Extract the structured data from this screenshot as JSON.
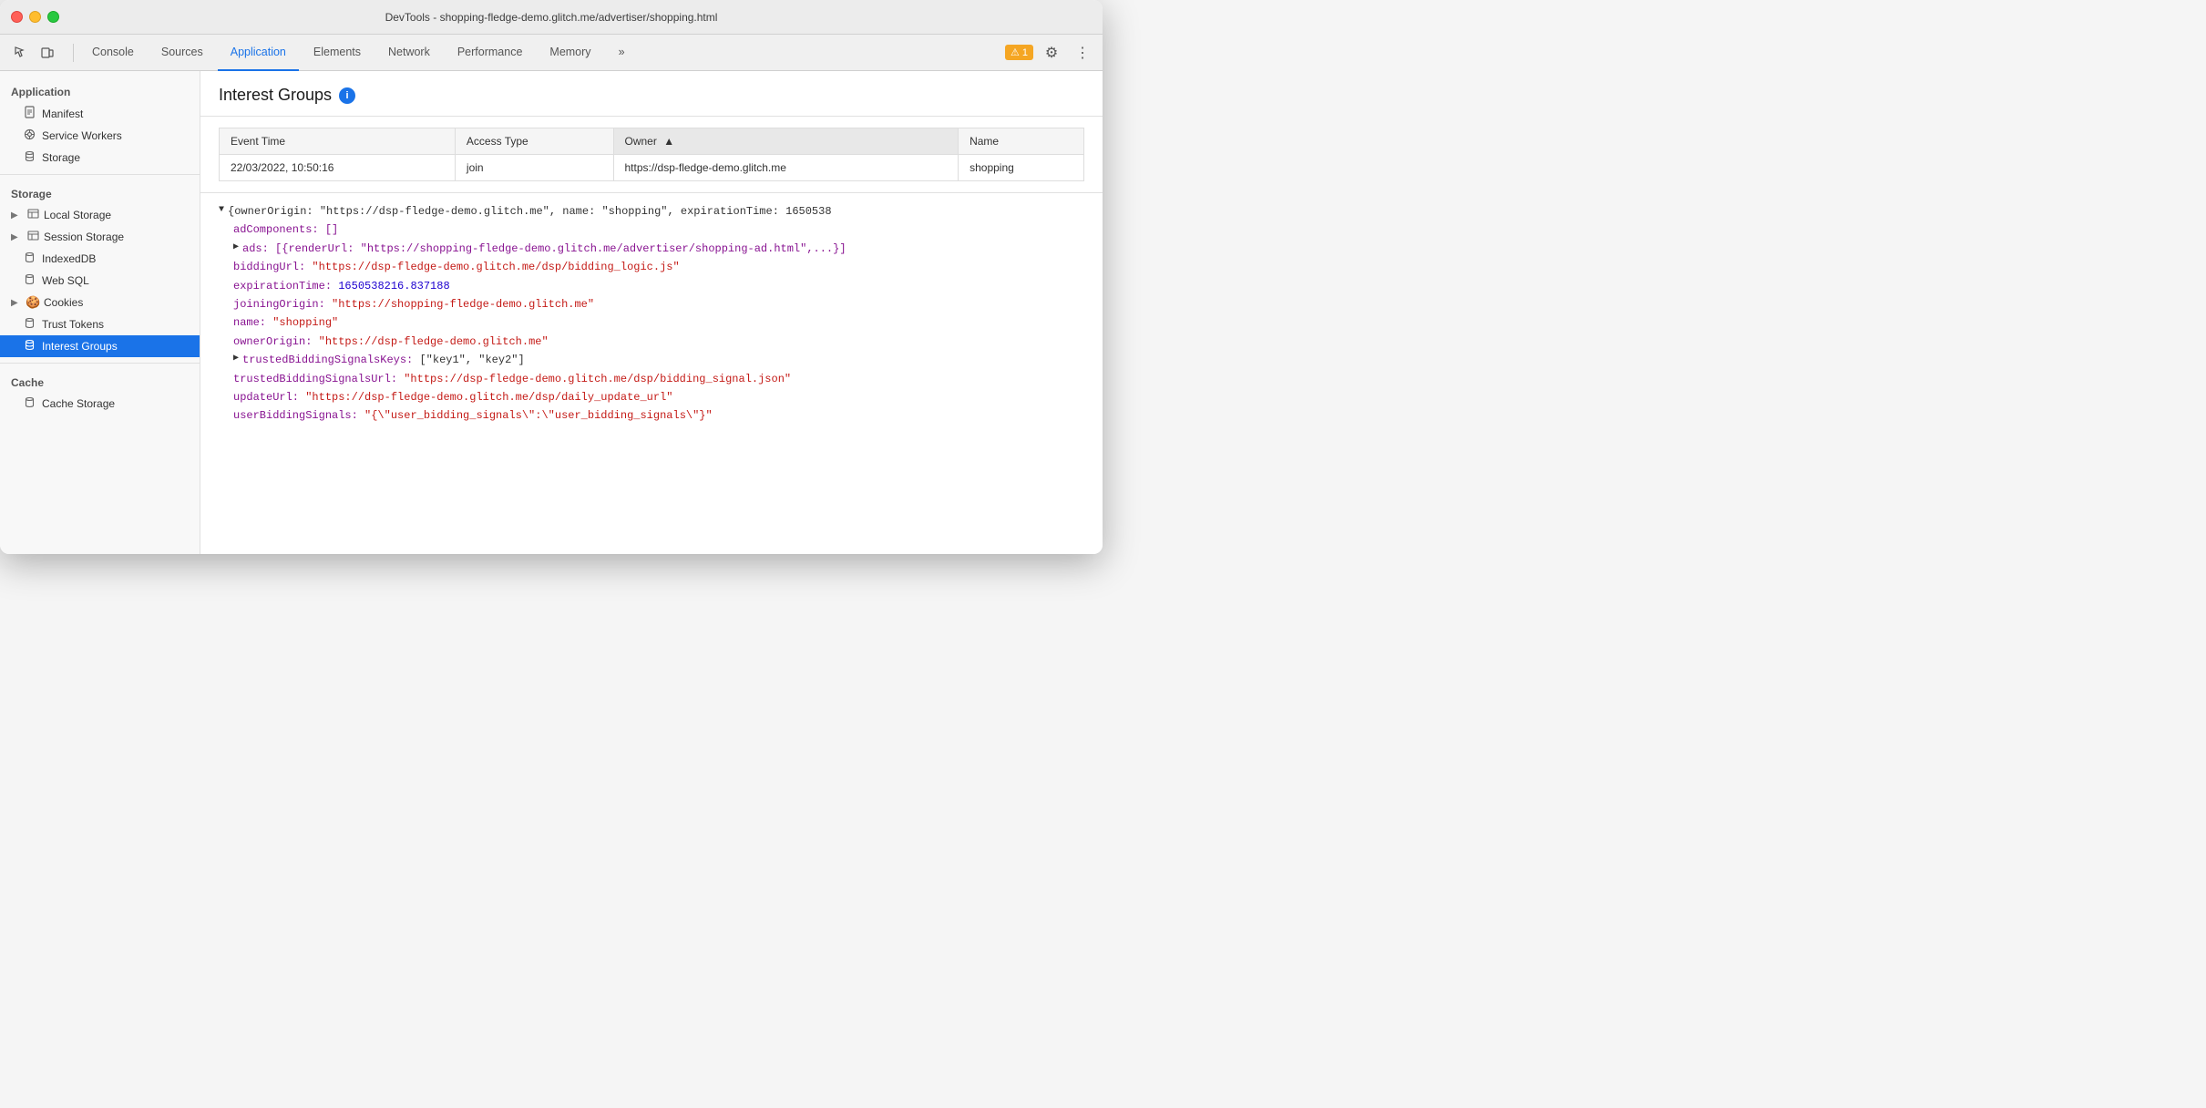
{
  "window": {
    "title": "DevTools - shopping-fledge-demo.glitch.me/advertiser/shopping.html"
  },
  "toolbar": {
    "tabs": [
      {
        "id": "console",
        "label": "Console",
        "active": false
      },
      {
        "id": "sources",
        "label": "Sources",
        "active": false
      },
      {
        "id": "application",
        "label": "Application",
        "active": true
      },
      {
        "id": "elements",
        "label": "Elements",
        "active": false
      },
      {
        "id": "network",
        "label": "Network",
        "active": false
      },
      {
        "id": "performance",
        "label": "Performance",
        "active": false
      },
      {
        "id": "memory",
        "label": "Memory",
        "active": false
      }
    ],
    "more_label": "»",
    "warning_count": "1",
    "warning_icon": "⚠"
  },
  "sidebar": {
    "sections": [
      {
        "id": "application",
        "title": "Application",
        "items": [
          {
            "id": "manifest",
            "label": "Manifest",
            "icon": "📄",
            "icon_type": "file"
          },
          {
            "id": "service-workers",
            "label": "Service Workers",
            "icon": "⚙",
            "icon_type": "gear"
          },
          {
            "id": "storage",
            "label": "Storage",
            "icon": "🗄",
            "icon_type": "db"
          }
        ]
      },
      {
        "id": "storage",
        "title": "Storage",
        "items": [
          {
            "id": "local-storage",
            "label": "Local Storage",
            "icon": "⊞",
            "icon_type": "grid",
            "expandable": true
          },
          {
            "id": "session-storage",
            "label": "Session Storage",
            "icon": "⊞",
            "icon_type": "grid",
            "expandable": true
          },
          {
            "id": "indexeddb",
            "label": "IndexedDB",
            "icon": "🗄",
            "icon_type": "db",
            "expandable": false
          },
          {
            "id": "web-sql",
            "label": "Web SQL",
            "icon": "🗄",
            "icon_type": "db",
            "expandable": false
          },
          {
            "id": "cookies",
            "label": "Cookies",
            "icon": "🍪",
            "icon_type": "cookie",
            "expandable": true
          },
          {
            "id": "trust-tokens",
            "label": "Trust Tokens",
            "icon": "🗄",
            "icon_type": "db",
            "expandable": false
          },
          {
            "id": "interest-groups",
            "label": "Interest Groups",
            "icon": "🗄",
            "icon_type": "db",
            "expandable": false,
            "active": true
          }
        ]
      },
      {
        "id": "cache",
        "title": "Cache",
        "items": [
          {
            "id": "cache-storage",
            "label": "Cache Storage",
            "icon": "🗄",
            "icon_type": "db",
            "expandable": false
          }
        ]
      }
    ]
  },
  "detail": {
    "title": "Interest Groups",
    "table": {
      "columns": [
        {
          "id": "event_time",
          "label": "Event Time"
        },
        {
          "id": "access_type",
          "label": "Access Type"
        },
        {
          "id": "owner",
          "label": "Owner",
          "sorted": true,
          "sort_direction": "asc"
        },
        {
          "id": "name",
          "label": "Name"
        }
      ],
      "rows": [
        {
          "event_time": "22/03/2022, 10:50:16",
          "access_type": "join",
          "owner": "https://dsp-fledge-demo.glitch.me",
          "name": "shopping"
        }
      ]
    },
    "json_content": {
      "owner_origin_line": "{ownerOrigin: \"https://dsp-fledge-demo.glitch.me\", name: \"shopping\", expirationTime: 1650538",
      "ad_components_line": "adComponents: []",
      "ads_line": "ads: [{renderUrl: \"https://shopping-fledge-demo.glitch.me/advertiser/shopping-ad.html\",...}]",
      "bidding_url_key": "biddingUrl:",
      "bidding_url_val": "\"https://dsp-fledge-demo.glitch.me/dsp/bidding_logic.js\"",
      "expiration_time_key": "expirationTime:",
      "expiration_time_val": "1650538216.837188",
      "joining_origin_key": "joiningOrigin:",
      "joining_origin_val": "\"https://shopping-fledge-demo.glitch.me\"",
      "name_key": "name:",
      "name_val": "\"shopping\"",
      "owner_origin_key": "ownerOrigin:",
      "owner_origin_val": "\"https://dsp-fledge-demo.glitch.me\"",
      "trusted_keys_key": "trustedBiddingSignalsKeys:",
      "trusted_keys_val": "[\"key1\", \"key2\"]",
      "trusted_url_key": "trustedBiddingSignalsUrl:",
      "trusted_url_val": "\"https://dsp-fledge-demo.glitch.me/dsp/bidding_signal.json\"",
      "update_url_key": "updateUrl:",
      "update_url_val": "\"https://dsp-fledge-demo.glitch.me/dsp/daily_update_url\"",
      "user_bidding_key": "userBiddingSignals:",
      "user_bidding_val": "\"{\\\"user_bidding_signals\\\":\\\"user_bidding_signals\\\"}\""
    }
  }
}
